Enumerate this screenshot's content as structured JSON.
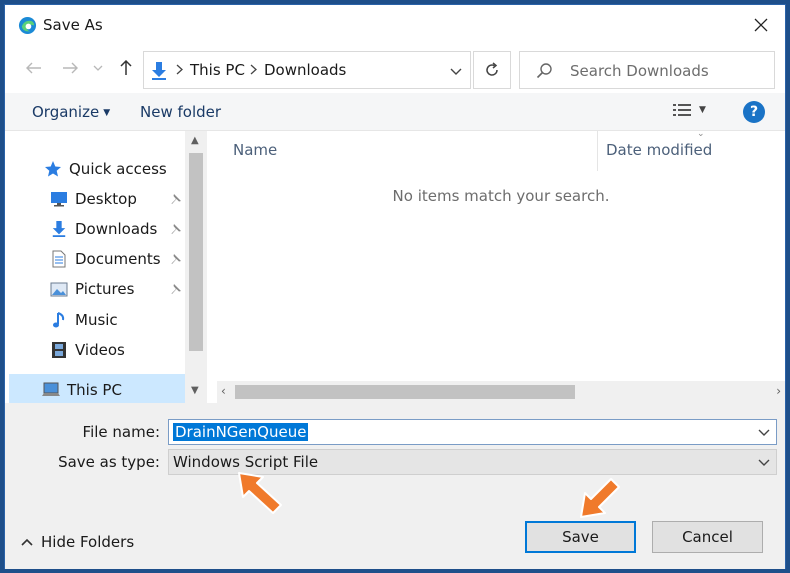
{
  "window": {
    "title": "Save As"
  },
  "address": {
    "crumbs": [
      "This PC",
      "Downloads"
    ]
  },
  "search": {
    "placeholder": "Search Downloads"
  },
  "toolbar": {
    "organize": "Organize",
    "new_folder": "New folder",
    "help": "?"
  },
  "nav": {
    "items": [
      {
        "label": "Quick access",
        "icon": "star-icon"
      },
      {
        "label": "Desktop",
        "icon": "desktop-icon"
      },
      {
        "label": "Downloads",
        "icon": "download-arrow-icon"
      },
      {
        "label": "Documents",
        "icon": "document-icon"
      },
      {
        "label": "Pictures",
        "icon": "pictures-icon"
      },
      {
        "label": "Music",
        "icon": "music-note-icon"
      },
      {
        "label": "Videos",
        "icon": "video-film-icon"
      },
      {
        "label": "This PC",
        "icon": "computer-icon"
      }
    ]
  },
  "filelist": {
    "columns": [
      "Name",
      "Date modified"
    ],
    "empty_message": "No items match your search."
  },
  "form": {
    "file_name_label": "File name:",
    "file_name_value": "DrainNGenQueue",
    "save_type_label": "Save as type:",
    "save_type_value": "Windows Script File"
  },
  "footer": {
    "hide_folders": "Hide Folders",
    "save": "Save",
    "cancel": "Cancel"
  },
  "colors": {
    "accent": "#0078d7",
    "annotation_arrow": "#f07a2b"
  }
}
